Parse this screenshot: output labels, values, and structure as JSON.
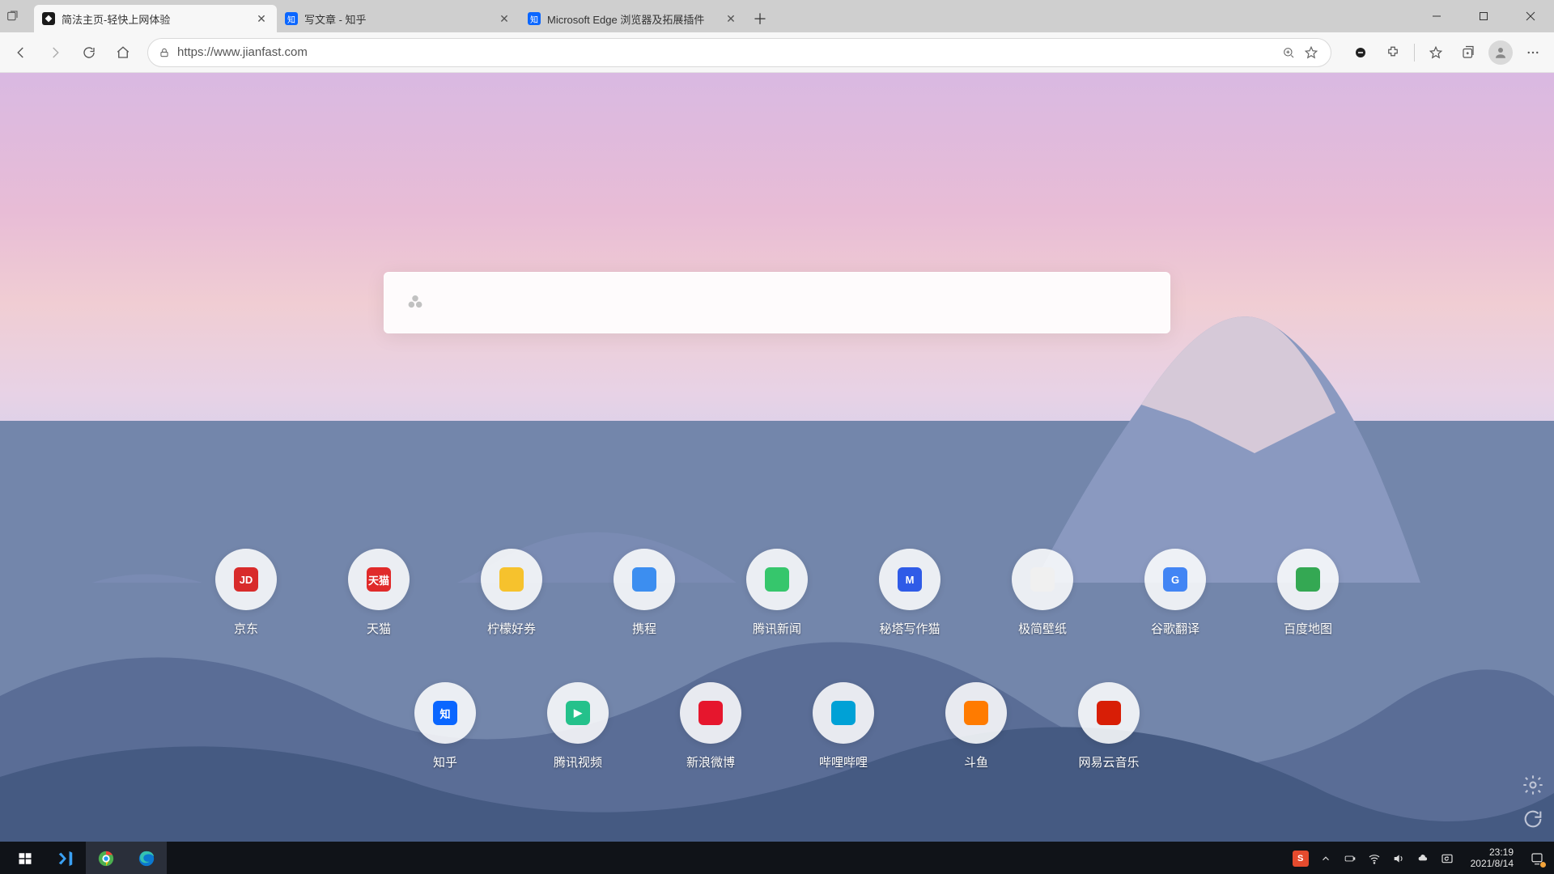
{
  "titlebar": {
    "tabs": [
      {
        "title": "简法主页-轻快上网体验",
        "favicon": "jianfast",
        "favicon_bg": "#1a1a1a"
      },
      {
        "title": "写文章 - 知乎",
        "favicon": "知",
        "favicon_bg": "#0a66ff"
      },
      {
        "title": "Microsoft Edge 浏览器及拓展插件",
        "favicon": "知",
        "favicon_bg": "#0a66ff"
      }
    ]
  },
  "toolbar": {
    "url": "https://www.jianfast.com"
  },
  "tiles_row1": [
    {
      "label": "京东",
      "bg": "#d82b2b",
      "txt": "JD"
    },
    {
      "label": "天猫",
      "bg": "#e02a2a",
      "txt": "天猫"
    },
    {
      "label": "柠檬好券",
      "bg": "#f6c22d",
      "txt": ""
    },
    {
      "label": "携程",
      "bg": "#3c8ef0",
      "txt": ""
    },
    {
      "label": "腾讯新闻",
      "bg": "#36c66c",
      "txt": ""
    },
    {
      "label": "秘塔写作猫",
      "bg": "#2f5be7",
      "txt": "M"
    },
    {
      "label": "极简壁纸",
      "bg": "#f0f0f0",
      "txt": ""
    },
    {
      "label": "谷歌翻译",
      "bg": "#4285f4",
      "txt": "G"
    },
    {
      "label": "百度地图",
      "bg": "#34a853",
      "txt": ""
    }
  ],
  "tiles_row2": [
    {
      "label": "知乎",
      "bg": "#0a66ff",
      "txt": "知"
    },
    {
      "label": "腾讯视频",
      "bg": "#24c18b",
      "txt": "▶"
    },
    {
      "label": "新浪微博",
      "bg": "#e6162d",
      "txt": ""
    },
    {
      "label": "哔哩哔哩",
      "bg": "#00a1d6",
      "txt": ""
    },
    {
      "label": "斗鱼",
      "bg": "#ff7b00",
      "txt": ""
    },
    {
      "label": "网易云音乐",
      "bg": "#d81e06",
      "txt": ""
    }
  ],
  "taskbar": {
    "time": "23:19",
    "date": "2021/8/14"
  }
}
